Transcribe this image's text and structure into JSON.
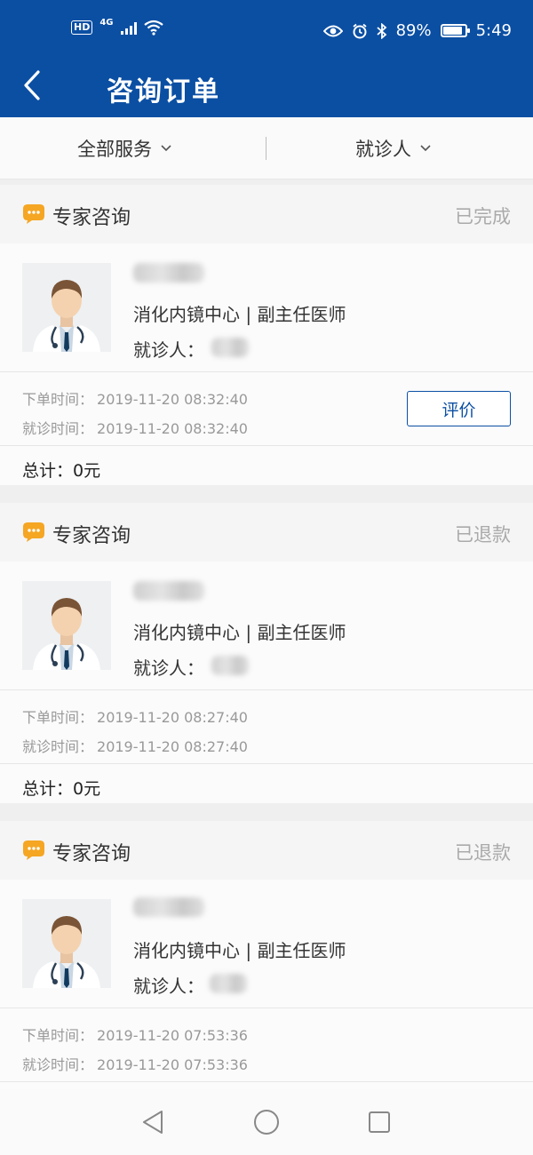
{
  "statusbar": {
    "hd": "HD",
    "network": "4G",
    "battery_percent": "89%",
    "battery_level": 0.89,
    "time": "5:49",
    "icons": [
      "wifi-icon",
      "eye-icon",
      "alarm-icon",
      "bluetooth-icon",
      "battery-icon"
    ]
  },
  "header": {
    "title": "咨询订单",
    "back_icon": "back-chevron-icon"
  },
  "filters": {
    "all_services": "全部服务",
    "patient": "就诊人"
  },
  "orders": [
    {
      "service": "专家咨询",
      "status": "已完成",
      "department": "消化内镜中心 | 副主任医师",
      "patient_label": "就诊人：",
      "order_time_label": "下单时间：",
      "order_time": "2019-11-20 08:32:40",
      "visit_time_label": "就诊时间：",
      "visit_time": "2019-11-20 08:32:40",
      "review_button": "评价",
      "total": "总计：0元"
    },
    {
      "service": "专家咨询",
      "status": "已退款",
      "department": "消化内镜中心 | 副主任医师",
      "patient_label": "就诊人：",
      "order_time_label": "下单时间：",
      "order_time": "2019-11-20 08:27:40",
      "visit_time_label": "就诊时间：",
      "visit_time": "2019-11-20 08:27:40",
      "total": "总计：0元"
    },
    {
      "service": "专家咨询",
      "status": "已退款",
      "department": "消化内镜中心 | 副主任医师",
      "patient_label": "就诊人：",
      "order_time_label": "下单时间：",
      "order_time": "2019-11-20 07:53:36",
      "visit_time_label": "就诊时间：",
      "visit_time": "2019-11-20 07:53:36"
    }
  ],
  "colors": {
    "brand_blue": "#0b4fa3",
    "chat_icon_orange": "#f5a623",
    "status_gray": "#aaaaaa"
  }
}
